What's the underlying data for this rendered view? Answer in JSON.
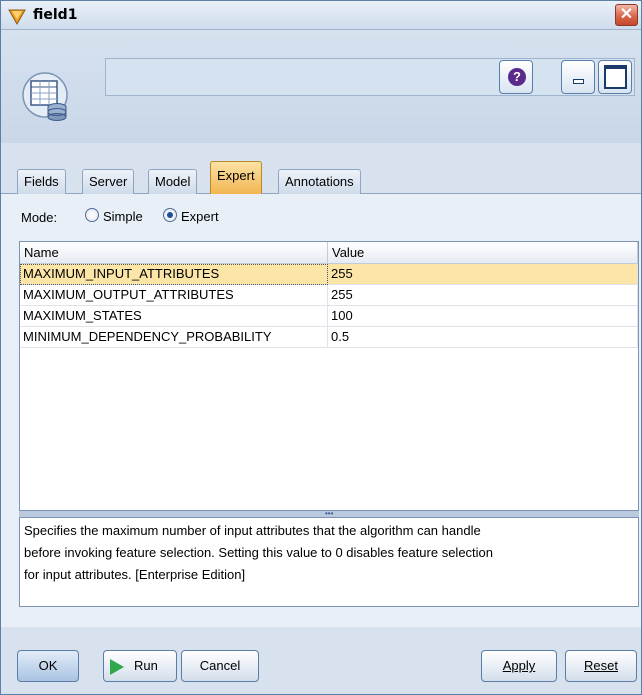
{
  "window": {
    "title": "field1",
    "close_glyph": "✕"
  },
  "header": {
    "help_glyph": "?"
  },
  "tabs": [
    {
      "label": "Fields"
    },
    {
      "label": "Server"
    },
    {
      "label": "Model"
    },
    {
      "label": "Expert",
      "active": true
    },
    {
      "label": "Annotations"
    }
  ],
  "mode": {
    "label": "Mode:",
    "options": [
      {
        "label": "Simple",
        "selected": false
      },
      {
        "label": "Expert",
        "selected": true
      }
    ]
  },
  "table": {
    "columns": [
      "Name",
      "Value"
    ],
    "rows": [
      {
        "name": "MAXIMUM_INPUT_ATTRIBUTES",
        "value": "255",
        "selected": true
      },
      {
        "name": "MAXIMUM_OUTPUT_ATTRIBUTES",
        "value": "255"
      },
      {
        "name": "MAXIMUM_STATES",
        "value": "100"
      },
      {
        "name": "MINIMUM_DEPENDENCY_PROBABILITY",
        "value": "0.5"
      }
    ]
  },
  "splitter": {
    "glyph": "•••"
  },
  "description": {
    "lines": [
      "Specifies the maximum number of input attributes that the algorithm can handle",
      "before invoking feature selection. Setting this value to 0 disables feature selection",
      "for input attributes. [Enterprise Edition]"
    ]
  },
  "buttons": {
    "ok": "OK",
    "run": "Run",
    "cancel": "Cancel",
    "apply": "Apply",
    "reset": "Reset"
  },
  "colors": {
    "accent_tab": "#f3b652",
    "selected_row": "#fbe6a8",
    "run_icon": "#2ea84a"
  },
  "icons": {
    "title": "diamond-node-icon",
    "node": "table-database-node-icon",
    "help": "help-icon",
    "minimize": "minimize-icon",
    "maximize": "maximize-icon",
    "close": "close-icon",
    "run": "play-icon"
  }
}
